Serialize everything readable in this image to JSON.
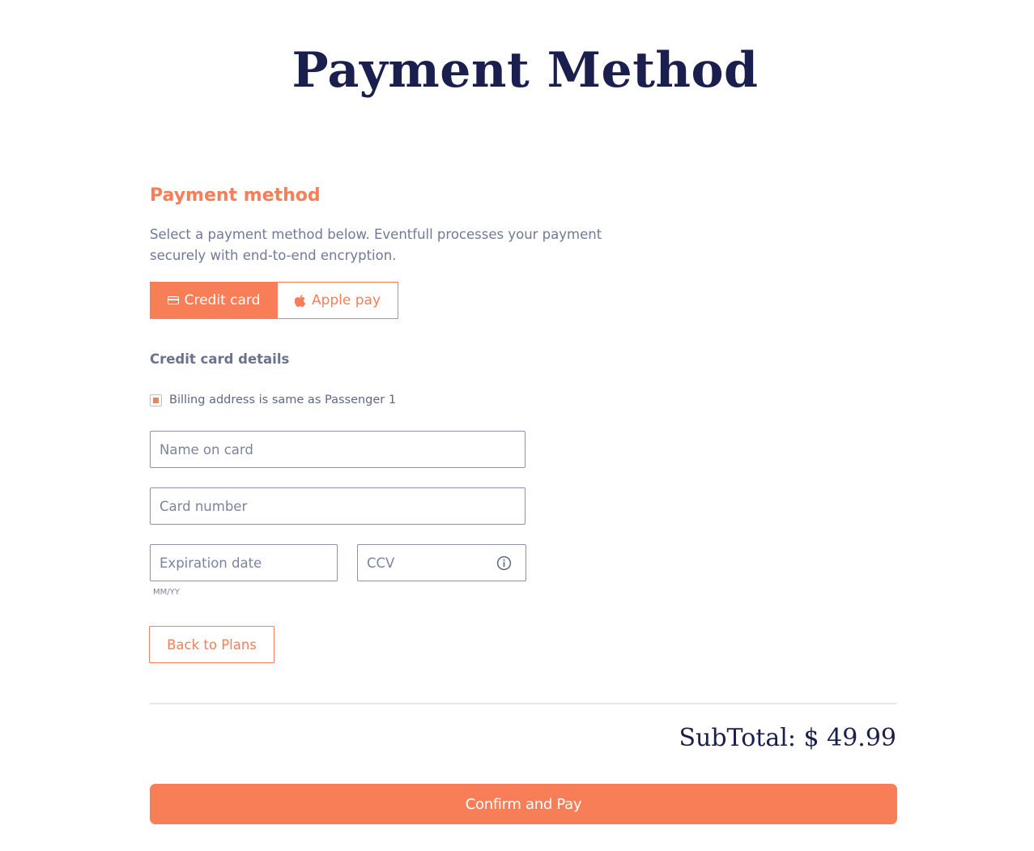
{
  "page_title": "Payment Method",
  "section": {
    "title": "Payment method",
    "description": "Select a payment method below. Eventfull processes your payment securely with end-to-end encryption."
  },
  "methods": [
    {
      "label": "Credit card",
      "icon": "credit-card-icon",
      "selected": true
    },
    {
      "label": "Apple pay",
      "icon": "apple-icon",
      "selected": false
    }
  ],
  "card_details": {
    "title": "Credit card details",
    "billing_same_label": "Billing address is same as Passenger 1",
    "billing_same_checked": true,
    "name_placeholder": "Name on card",
    "number_placeholder": "Card number",
    "expiration_placeholder": "Expiration date",
    "expiration_hint": "MM/YY",
    "ccv_placeholder": "CCV"
  },
  "actions": {
    "back_label": "Back to Plans",
    "confirm_label": "Confirm and Pay"
  },
  "subtotal": "SubTotal: $ 49.99",
  "colors": {
    "accent": "#f77e56",
    "heading": "#1a1f4e",
    "muted": "#6f7a99"
  }
}
